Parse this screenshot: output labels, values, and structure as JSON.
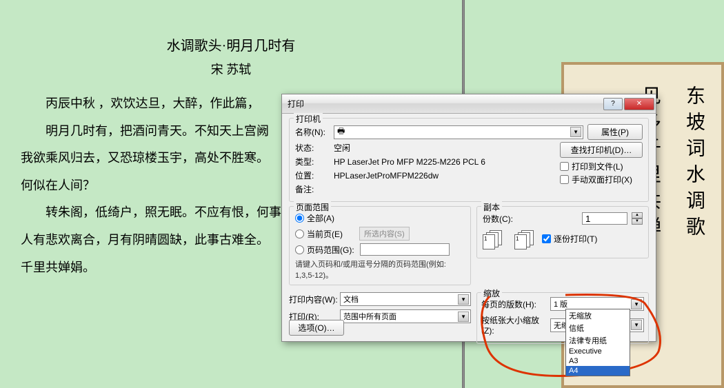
{
  "document": {
    "title": "水调歌头·明月几时有",
    "author": "宋 苏轼",
    "p1": "丙辰中秋 ，欢饮达旦，大醉，作此篇，",
    "p2": "明月几时有，把酒问青天。不知天上宫阙",
    "p3": "我欲乘风归去，又恐琼楼玉宇，高处不胜寒。",
    "p4": "何似在人间？",
    "p5": "转朱阁，低绮户，照无眠。不应有恨，何事",
    "p6": "人有悲欢离合，月有阴晴圆缺，此事古难全。",
    "p7": "千里共婵娟。"
  },
  "scroll": {
    "col1": "东坡词水调歌",
    "col2": "见多千里共婵"
  },
  "dialog": {
    "title": "打印",
    "printer": {
      "group": "打印机",
      "name_label": "名称(N):",
      "name_value": "",
      "status_label": "状态:",
      "status_value": "空闲",
      "type_label": "类型:",
      "type_value": "HP LaserJet Pro MFP M225-M226 PCL 6",
      "where_label": "位置:",
      "where_value": "HPLaserJetProMFPM226dw",
      "comment_label": "备注:",
      "properties_btn": "属性(P)",
      "find_btn": "查找打印机(D)…",
      "to_file": "打印到文件(L)",
      "duplex": "手动双面打印(X)"
    },
    "range": {
      "group": "页面范围",
      "all": "全部(A)",
      "current": "当前页(E)",
      "selection": "所选内容(S)",
      "pages": "页码范围(G):",
      "hint": "请键入页码和/或用逗号分隔的页码范围(例如: 1,3,5-12)。"
    },
    "copies": {
      "group": "副本",
      "count_label": "份数(C):",
      "count_value": "1",
      "collate": "逐份打印(T)"
    },
    "what": {
      "label": "打印内容(W):",
      "value": "文档",
      "print_label": "打印(R):",
      "print_value": "范围中所有页面"
    },
    "scale": {
      "group": "缩放",
      "per_sheet_label": "每页的版数(H):",
      "per_sheet_value": "1 版",
      "fit_label": "按纸张大小缩放(Z):",
      "fit_value": "无缩放",
      "options": {
        "o1": "无缩放",
        "o2": "信纸",
        "o3": "法律专用纸",
        "o4": "Executive",
        "o5": "A3",
        "o6": "A4"
      }
    },
    "options_btn": "选项(O)…"
  }
}
